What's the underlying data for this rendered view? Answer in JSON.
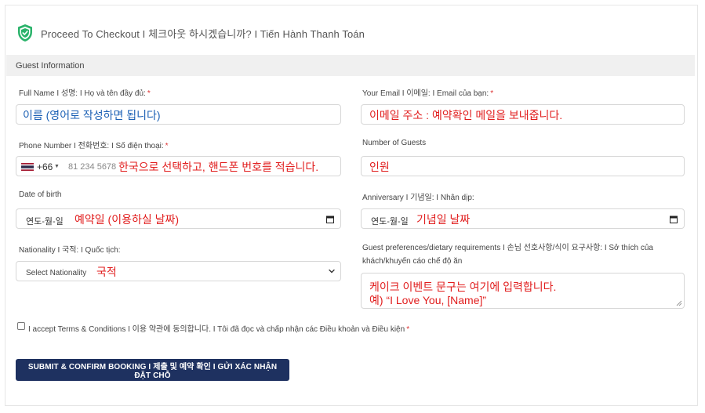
{
  "header": {
    "title": "Proceed To Checkout I 체크아웃 하시겠습니까? I Tiến Hành Thanh Toán",
    "shield_color": "#2bb36b"
  },
  "section": {
    "title": "Guest Information"
  },
  "fields": {
    "full_name": {
      "label": "Full Name I 성명: I Họ và tên đầy đủ:",
      "required_mark": "*",
      "overlay_text": "이름 (영어로 작성하면 됩니다)"
    },
    "email": {
      "label": "Your Email I 이메일: I Email của bạn:",
      "required_mark": "*",
      "overlay_text": "이메일 주소 : 예약확인 메일을 보내줍니다."
    },
    "phone": {
      "label": "Phone Number I 전화번호: I Số điện thoại:",
      "required_mark": "*",
      "country_code": "+66",
      "placeholder": "81 234 5678",
      "overlay_text": "한국으로 선택하고, 핸드폰 번호를 적습니다."
    },
    "guests": {
      "label": "Number of Guests",
      "overlay_text": "인원"
    },
    "dob": {
      "label": "Date of birth",
      "date_placeholder": "연도-월-일",
      "overlay_text": "예약일 (이용하실 날짜)"
    },
    "anniversary": {
      "label": "Anniversary I 기념일: I Nhân dịp:",
      "date_placeholder": "연도-월-일",
      "overlay_text": "기념일 날짜"
    },
    "nationality": {
      "label": "Nationality I 국적: I Quốc tịch:",
      "select_placeholder": "Select Nationality",
      "overlay_text": "국적"
    },
    "preferences": {
      "label_line1": "Guest preferences/dietary requirements I 손님 선호사항/식이 요구사항: I Sở thích của",
      "label_line2": "khách/khuyến cáo chế độ ăn",
      "overlay_line1": "케이크 이벤트 문구는 여기에 입력합니다.",
      "overlay_line2": "예) “I Love You, [Name]”"
    }
  },
  "terms": {
    "label": "I accept Terms & Conditions I 이용 약관에 동의합니다. I Tôi đã đọc và chấp nhận các Điều khoản và Điều kiện",
    "required_mark": "*"
  },
  "submit": {
    "label": "SUBMIT & CONFIRM BOOKING I 제출 및 예약 확인 I GỬI XÁC NHẬN ĐẶT CHỖ"
  },
  "colors": {
    "button_bg": "#1e3160",
    "annotation_blue": "#1a5fb4",
    "annotation_red": "#e11d1d"
  }
}
